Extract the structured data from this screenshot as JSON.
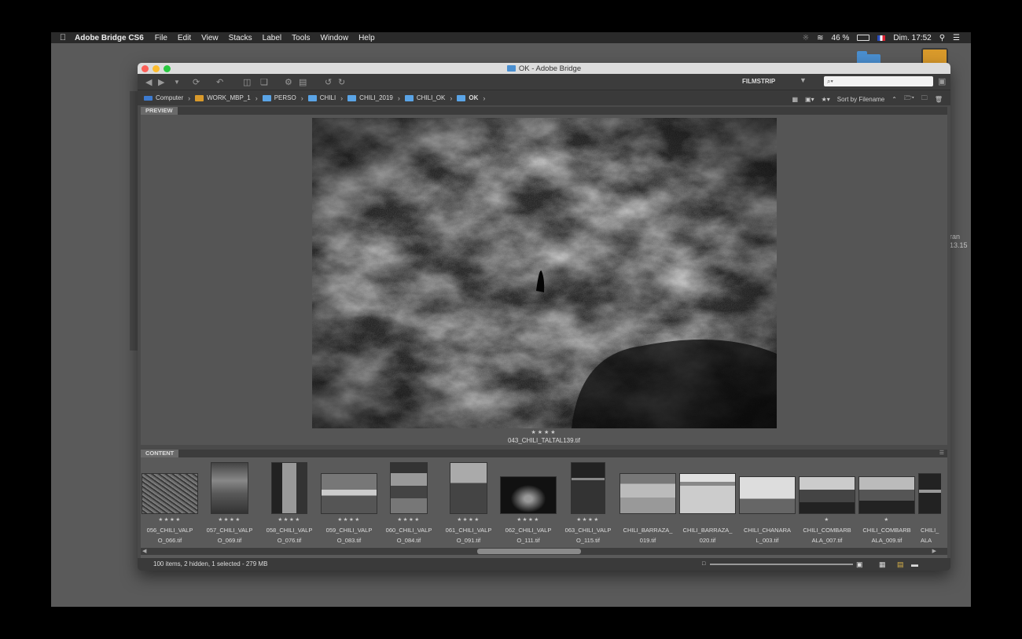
{
  "menubar": {
    "app": "Adobe Bridge CS6",
    "items": [
      "File",
      "Edit",
      "View",
      "Stacks",
      "Label",
      "Tools",
      "Window",
      "Help"
    ],
    "battery": "46 %",
    "clock": "Dim. 17:52"
  },
  "desktop": {
    "side_text": "ran\n13.15"
  },
  "window": {
    "title": "OK - Adobe Bridge"
  },
  "toolbar": {
    "workspace": "FILMSTRIP",
    "search_placeholder": "⌕▾"
  },
  "path": [
    {
      "label": "Computer"
    },
    {
      "label": "WORK_MBP_1"
    },
    {
      "label": "PERSO"
    },
    {
      "label": "CHILI"
    },
    {
      "label": "CHILI_2019"
    },
    {
      "label": "CHILI_OK"
    },
    {
      "label": "OK"
    }
  ],
  "sort": {
    "label": "Sort by Filename"
  },
  "preview": {
    "tab": "PREVIEW",
    "stars": "★★★★",
    "caption": "043_CHILI_TALTAL139.tif"
  },
  "content": {
    "tab": "CONTENT",
    "items": [
      {
        "stars": "★★★★",
        "name": "056_CHILI_VALP\nO_066.tif"
      },
      {
        "stars": "★★★★",
        "name": "057_CHILI_VALP\nO_069.tif"
      },
      {
        "stars": "★★★★",
        "name": "058_CHILI_VALP\nO_076.tif"
      },
      {
        "stars": "★★★★",
        "name": "059_CHILI_VALP\nO_083.tif"
      },
      {
        "stars": "★★★★",
        "name": "060_CHILI_VALP\nO_084.tif"
      },
      {
        "stars": "★★★★",
        "name": "061_CHILI_VALP\nO_091.tif"
      },
      {
        "stars": "★★★★",
        "name": "062_CHILI_VALP\nO_111.tif"
      },
      {
        "stars": "★★★★",
        "name": "063_CHILI_VALP\nO_115.tif"
      },
      {
        "stars": "",
        "name": "CHILI_BARRAZA_\n019.tif"
      },
      {
        "stars": "",
        "name": "CHILI_BARRAZA_\n020.tif"
      },
      {
        "stars": "",
        "name": "CHILI_CHANARA\nL_003.tif"
      },
      {
        "stars": "★",
        "name": "CHILI_COMBARB\nALA_007.tif"
      },
      {
        "stars": "★",
        "name": "CHILI_COMBARB\nALA_009.tif"
      },
      {
        "stars": "",
        "name": "CHILI_\nALA"
      }
    ]
  },
  "status": {
    "text": "100 items, 2 hidden, 1 selected - 279 MB"
  }
}
